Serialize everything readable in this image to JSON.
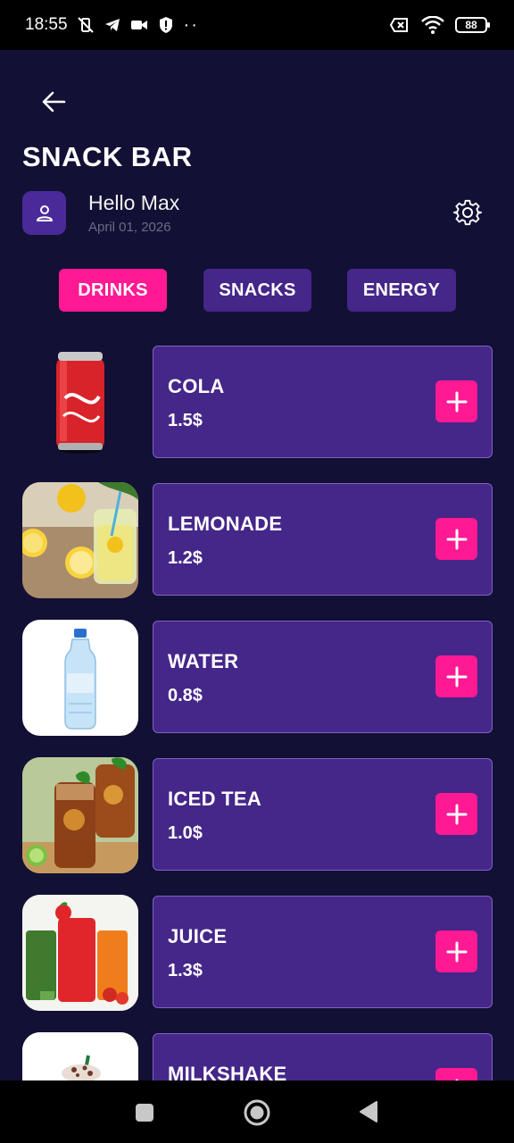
{
  "status_bar": {
    "time": "18:55",
    "battery": "88",
    "icons": [
      "mute-vibrate-icon",
      "telegram-icon",
      "video-icon",
      "shield-icon",
      "more-dots-icon",
      "sim-off-icon",
      "wifi-icon",
      "battery-icon"
    ]
  },
  "header": {
    "title": "SNACK BAR",
    "greeting": "Hello Max",
    "date": "April 01, 2026"
  },
  "tabs": [
    {
      "label": "DRINKS",
      "active": true
    },
    {
      "label": "SNACKS",
      "active": false
    },
    {
      "label": "ENERGY",
      "active": false
    }
  ],
  "products": [
    {
      "name": "COLA",
      "price": "1.5$",
      "image": "cola-can"
    },
    {
      "name": "LEMONADE",
      "price": "1.2$",
      "image": "lemonade-glass"
    },
    {
      "name": "WATER",
      "price": "0.8$",
      "image": "water-bottle"
    },
    {
      "name": "ICED TEA",
      "price": "1.0$",
      "image": "iced-tea-glasses"
    },
    {
      "name": "JUICE",
      "price": "1.3$",
      "image": "juice-glasses"
    },
    {
      "name": "MILKSHAKE",
      "price": "",
      "image": "milkshake-cup"
    }
  ],
  "colors": {
    "background": "#121034",
    "accent": "#ff1993",
    "card": "#452689",
    "card_border": "#7d63c3",
    "muted_text": "#6b6b86"
  }
}
